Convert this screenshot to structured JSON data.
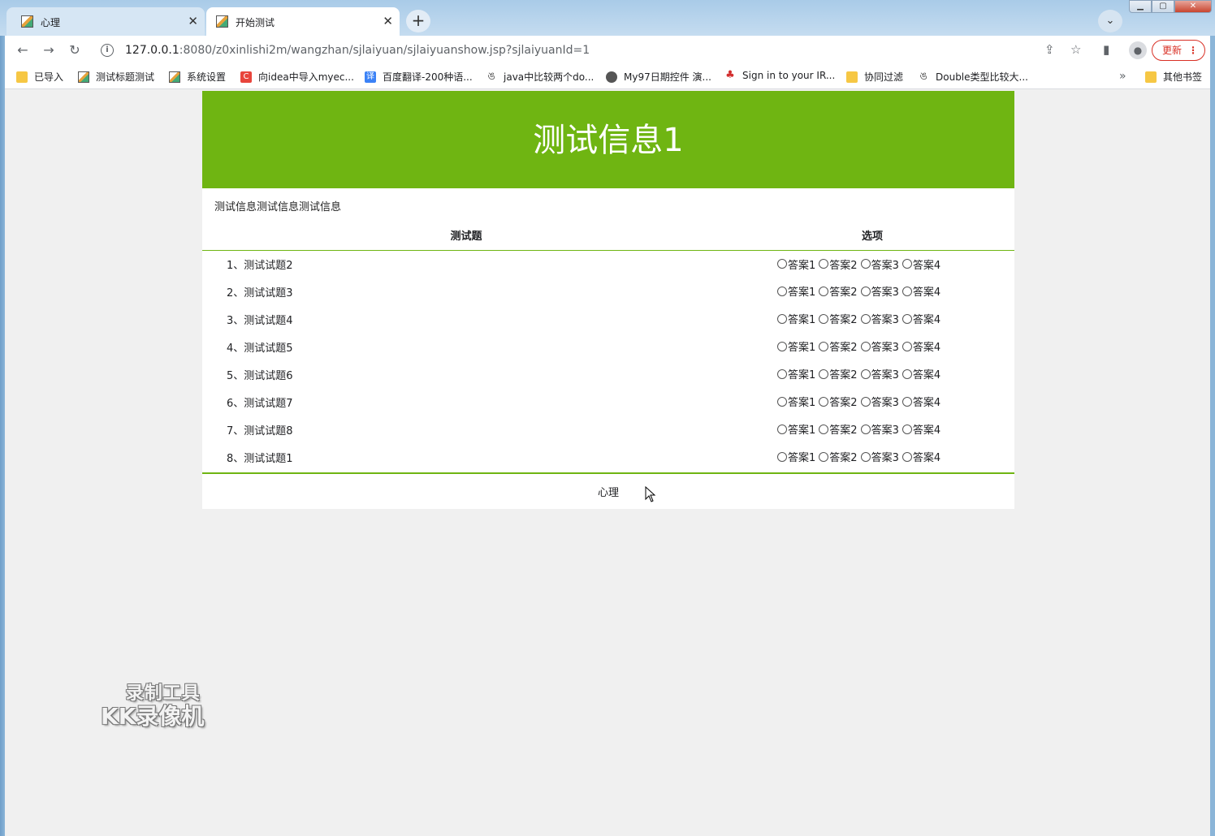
{
  "browser": {
    "tabs": [
      {
        "title": "心理",
        "active": false
      },
      {
        "title": "开始测试",
        "active": true
      }
    ],
    "new_tab": "+",
    "url_host": "127.0.0.1",
    "url_path": ":8080/z0xinlishi2m/wangzhan/sjlaiyuan/sjlaiyuanshow.jsp?sjlaiyuanId=1",
    "update_label": "更新",
    "bookmarks": [
      {
        "label": "已导入",
        "icon": "folder-icon"
      },
      {
        "label": "测试标题测试",
        "icon": "image-icon"
      },
      {
        "label": "系统设置",
        "icon": "image-icon"
      },
      {
        "label": "向idea中导入myec...",
        "icon": "csdn-icon"
      },
      {
        "label": "百度翻译-200种语...",
        "icon": "translate-icon"
      },
      {
        "label": "java中比较两个do...",
        "icon": "segmentfault-icon"
      },
      {
        "label": "My97日期控件 演...",
        "icon": "globe-icon"
      },
      {
        "label": "Sign in to your IR...",
        "icon": "maple-leaf-icon"
      },
      {
        "label": "协同过滤",
        "icon": "folder-icon"
      },
      {
        "label": "Double类型比较大...",
        "icon": "segmentfault-icon"
      }
    ],
    "other_bookmarks": "其他书签"
  },
  "page": {
    "title": "测试信息1",
    "description": "测试信息测试信息测试信息",
    "col_question": "测试题",
    "col_options": "选项",
    "questions": [
      {
        "label": "1、测试试题2"
      },
      {
        "label": "2、测试试题3"
      },
      {
        "label": "3、测试试题4"
      },
      {
        "label": "4、测试试题5"
      },
      {
        "label": "5、测试试题6"
      },
      {
        "label": "6、测试试题7"
      },
      {
        "label": "7、测试试题8"
      },
      {
        "label": "8、测试试题1"
      }
    ],
    "options": [
      "答案1",
      "答案2",
      "答案3",
      "答案4"
    ],
    "footer": "心理"
  },
  "watermark": {
    "line1": "录制工具",
    "line2": "KK录像机"
  },
  "colors": {
    "accent": "#6fb512",
    "page_bg": "#f0f0f0"
  }
}
